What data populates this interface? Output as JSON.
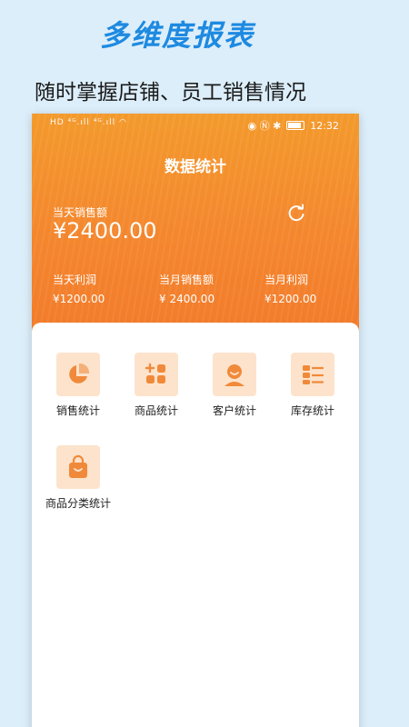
{
  "promo": {
    "title": "多维度报表",
    "subtitle": "随时掌握店铺、员工销售情况"
  },
  "statusbar": {
    "left": "HD ⁴ᴳ.ıll ⁴ᴳ.ıll ◠",
    "right_icons": "◉ Ⓝ ✱",
    "battery": "98",
    "time": "12:32"
  },
  "header": {
    "title": "数据统计",
    "today_label": "当天销售额",
    "today_value": "¥2400.00",
    "stats": [
      {
        "label": "当天利润",
        "value": "¥1200.00"
      },
      {
        "label": "当月销售额",
        "value": "¥ 2400.00"
      },
      {
        "label": "当月利润",
        "value": "¥1200.00"
      }
    ]
  },
  "tiles": [
    {
      "label": "销售统计",
      "icon": "pie-chart-icon"
    },
    {
      "label": "商品统计",
      "icon": "grid-add-icon"
    },
    {
      "label": "客户统计",
      "icon": "user-icon"
    },
    {
      "label": "库存统计",
      "icon": "list-icon"
    },
    {
      "label": "商品分类统计",
      "icon": "shopping-bag-icon"
    }
  ],
  "colors": {
    "accent": "#f4862e",
    "icon_fg": "#f08a3a",
    "icon_bg": "#fde3cc",
    "promo_title": "#1e8ae0",
    "background": "#dceefa"
  }
}
